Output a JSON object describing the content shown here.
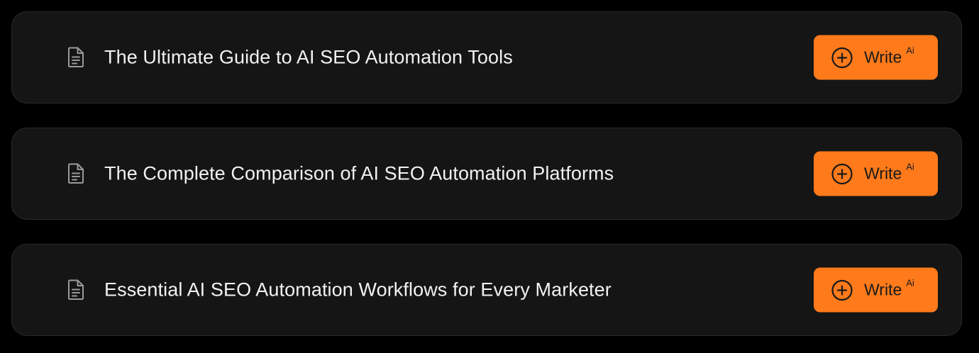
{
  "colors": {
    "background": "#000000",
    "card": "#151515",
    "accent": "#ff7a1a",
    "text": "#f2f2f2"
  },
  "items": [
    {
      "icon": "document-icon",
      "title": "The Ultimate Guide to AI SEO Automation Tools",
      "button": {
        "icon": "plus-circle-icon",
        "label": "Write",
        "badge": "Ai"
      }
    },
    {
      "icon": "document-icon",
      "title": "The Complete Comparison of AI SEO Automation Platforms",
      "button": {
        "icon": "plus-circle-icon",
        "label": "Write",
        "badge": "Ai"
      }
    },
    {
      "icon": "document-icon",
      "title": "Essential AI SEO Automation Workflows for Every Marketer",
      "button": {
        "icon": "plus-circle-icon",
        "label": "Write",
        "badge": "Ai"
      }
    }
  ]
}
